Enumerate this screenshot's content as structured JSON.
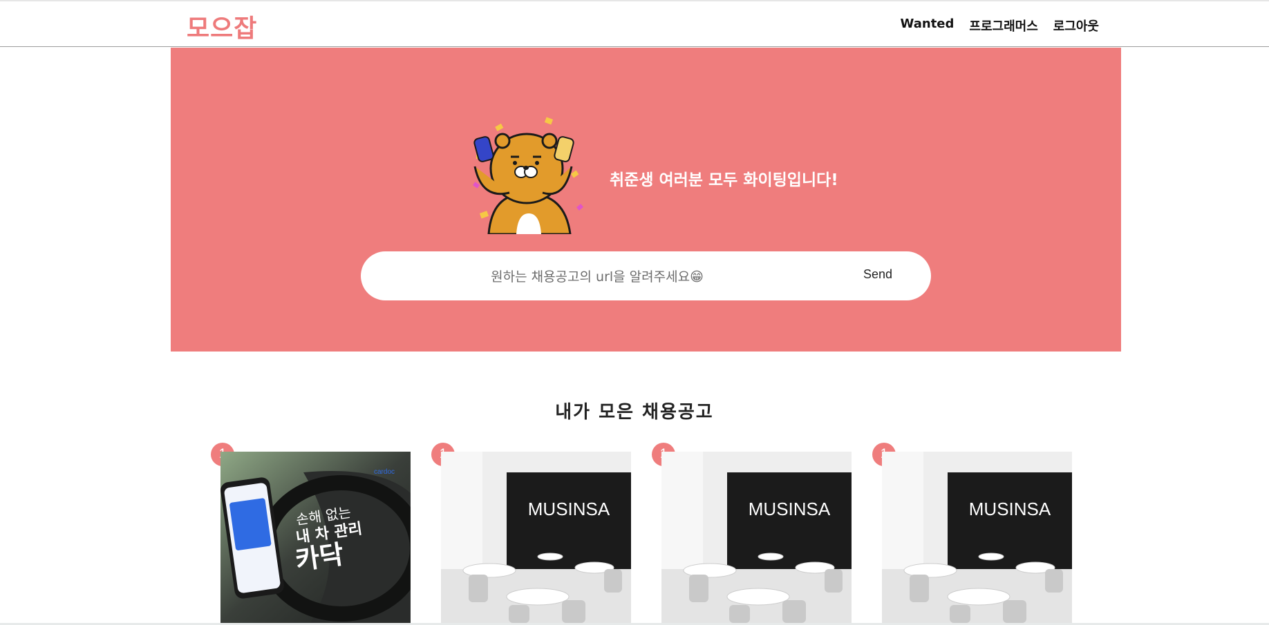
{
  "app": {
    "logo": "모으잡"
  },
  "nav": {
    "items": [
      "Wanted",
      "프로그래머스",
      "로그아웃"
    ]
  },
  "hero": {
    "message": "취준생 여러분 모두 화이팅입니다!",
    "search_placeholder": "원하는 채용공고의 url을 알려주세요😁",
    "send_label": "Send"
  },
  "section": {
    "title": "내가 모은 채용공고"
  },
  "cards": [
    {
      "badge": "1",
      "brand": "cardoc",
      "headline_top": "손해 없는",
      "headline_mid": "내 차 관리",
      "headline_bottom": "카닥"
    },
    {
      "badge": "1",
      "brand": "MUSINSA"
    },
    {
      "badge": "1",
      "brand": "MUSINSA"
    },
    {
      "badge": "1",
      "brand": "MUSINSA"
    }
  ],
  "colors": {
    "accent": "#ef7d7d",
    "logo": "#ee7a7b"
  }
}
